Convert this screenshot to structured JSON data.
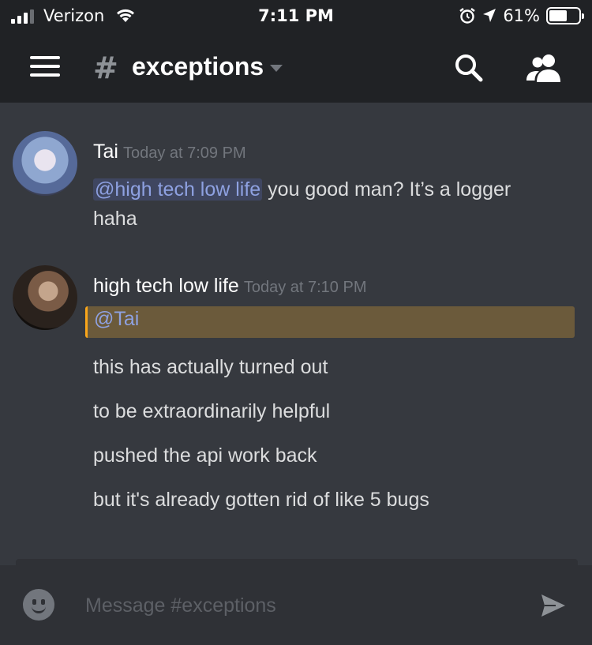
{
  "status_bar": {
    "carrier": "Verizon",
    "time": "7:11 PM",
    "battery_percent": "61%",
    "battery_level": 0.61,
    "icons": [
      "signal-icon",
      "wifi-icon",
      "alarm-icon",
      "location-icon",
      "battery-icon"
    ]
  },
  "header": {
    "channel_prefix": "#",
    "channel_name": "exceptions",
    "icons": [
      "menu-icon",
      "chevron-down-icon",
      "search-icon",
      "members-icon"
    ]
  },
  "messages": [
    {
      "author": "Tai",
      "timestamp": "Today at 7:09 PM",
      "mention": "@high tech low life",
      "text_after_mention": " you good man? It’s a logger",
      "text_line2": "haha"
    },
    {
      "author": "high tech low life",
      "timestamp": "Today at 7:10 PM",
      "mention": "@Tai",
      "lines": [
        "this has actually turned out",
        "to be extraordinarily helpful",
        "pushed the api work back",
        "but it's already gotten rid of like 5 bugs"
      ]
    }
  ],
  "composer": {
    "placeholder": "Message #exceptions",
    "icons": [
      "emoji-icon",
      "send-icon"
    ]
  },
  "colors": {
    "background": "#36393f",
    "header": "#202225",
    "mention_text": "#8ea1e1",
    "mention_highlight": "#6b5a3b",
    "mention_accent": "#faa61a"
  }
}
